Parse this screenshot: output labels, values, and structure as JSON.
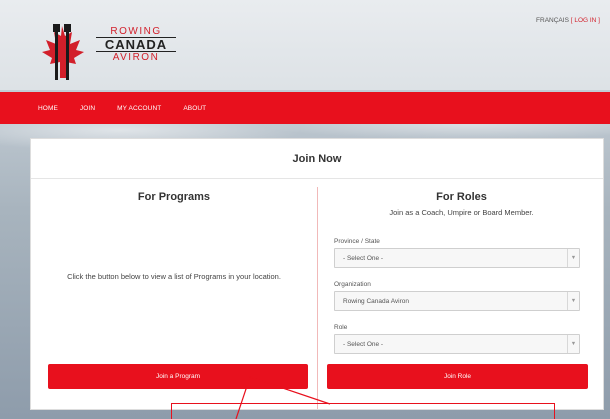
{
  "brand": {
    "line1": "ROWING",
    "line2": "CANADA",
    "line3": "AVIRON",
    "red": "#e8101d"
  },
  "header": {
    "lang_label": "FRANÇAIS",
    "login_label": "[ LOG IN ]"
  },
  "nav": {
    "items": [
      {
        "label": "HOME"
      },
      {
        "label": "JOIN"
      },
      {
        "label": "MY ACCOUNT"
      },
      {
        "label": "ABOUT"
      }
    ]
  },
  "panel": {
    "title": "Join Now",
    "programs": {
      "heading": "For Programs",
      "description": "Click the button below to view a list of Programs in your location.",
      "button": "Join a Program"
    },
    "roles": {
      "heading": "For Roles",
      "description": "Join as a Coach, Umpire or Board Member.",
      "fields": [
        {
          "label": "Province / State",
          "value": "- Select One -"
        },
        {
          "label": "Organization",
          "value": "Rowing Canada Aviron"
        },
        {
          "label": "Role",
          "value": "- Select One -"
        }
      ],
      "button": "Join Role"
    }
  },
  "icons": {
    "select_arrow": "chevron-down-icon",
    "logo": "maple-leaf-oars-icon"
  }
}
